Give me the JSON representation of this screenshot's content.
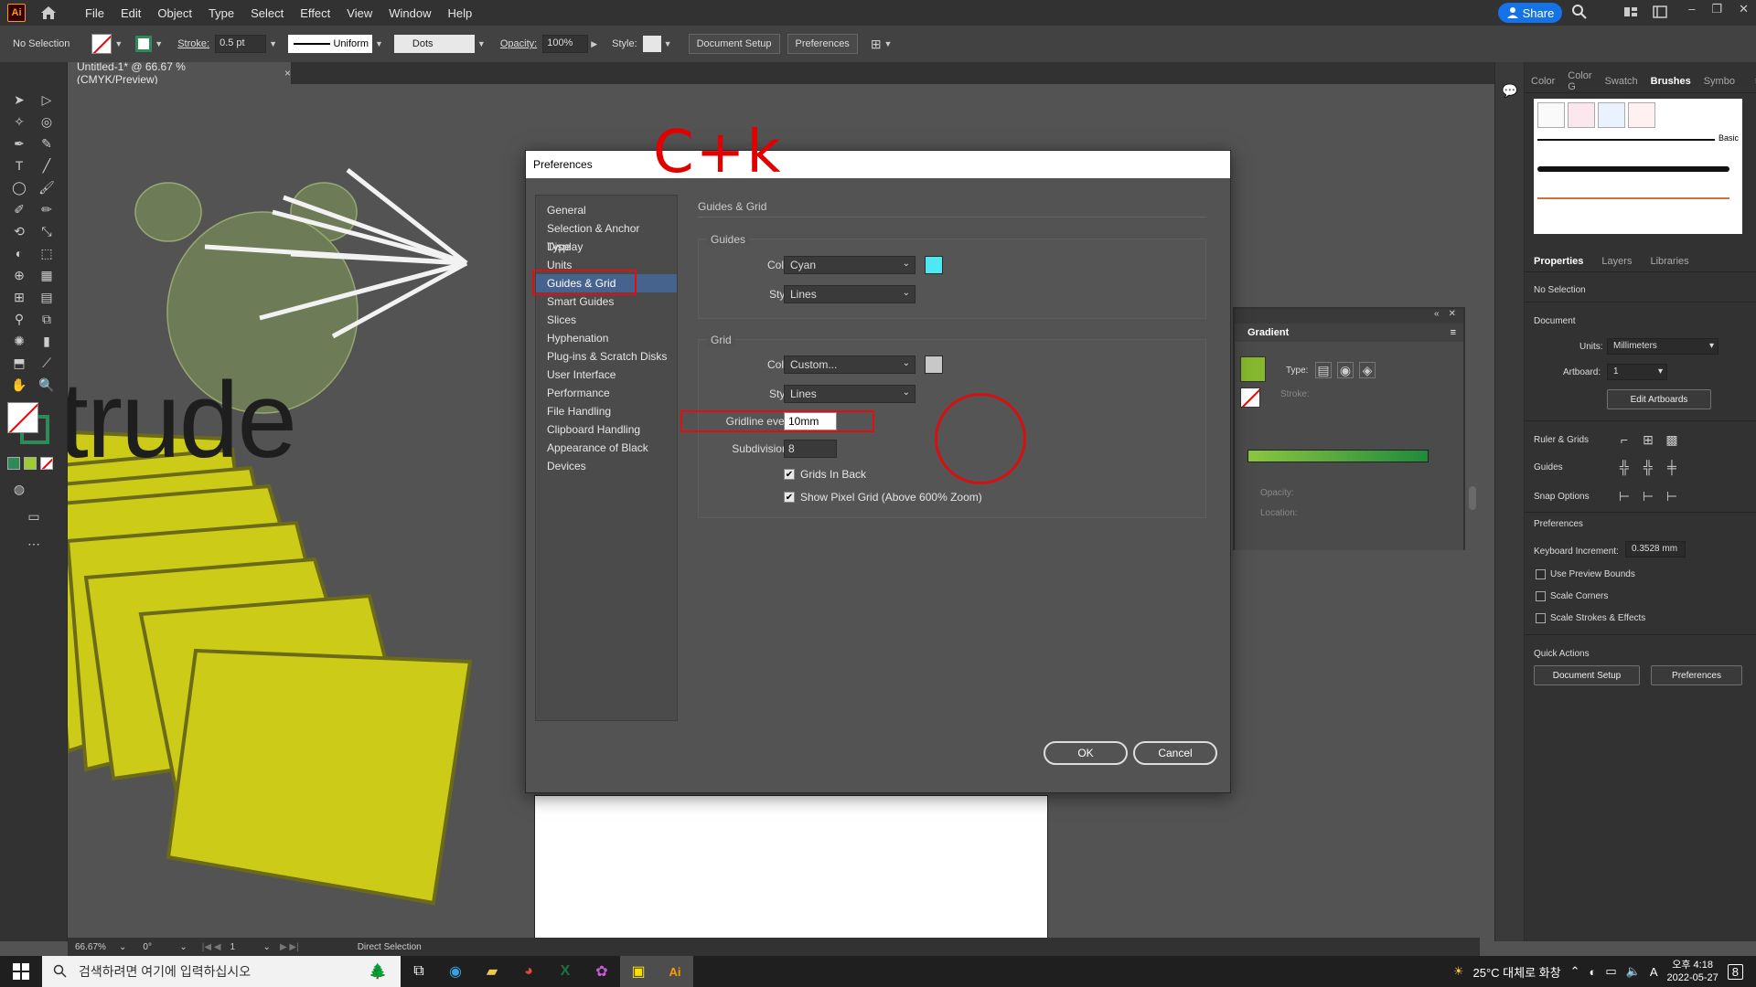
{
  "menubar": {
    "logo": "Ai",
    "items": [
      "File",
      "Edit",
      "Object",
      "Type",
      "Select",
      "Effect",
      "View",
      "Window",
      "Help"
    ],
    "share_label": "Share"
  },
  "controlbar": {
    "selection_text": "No Selection",
    "stroke_label": "Stroke:",
    "stroke_value": "0.5 pt",
    "stroke_profile": "Uniform",
    "brush_label": "Dots",
    "opacity_label": "Opacity:",
    "opacity_value": "100%",
    "style_label": "Style:",
    "document_setup_label": "Document Setup",
    "preferences_label": "Preferences"
  },
  "document_tab": {
    "title": "Untitled-1* @ 66.67 % (CMYK/Preview)",
    "close": "×"
  },
  "canvas": {
    "word": "trude"
  },
  "dialog": {
    "title": "Preferences",
    "categories": [
      "General",
      "Selection & Anchor Display",
      "Type",
      "Units",
      "Guides & Grid",
      "Smart Guides",
      "Slices",
      "Hyphenation",
      "Plug-ins & Scratch Disks",
      "User Interface",
      "Performance",
      "File Handling",
      "Clipboard Handling",
      "Appearance of Black",
      "Devices"
    ],
    "selected_category": "Guides & Grid",
    "content_title": "Guides & Grid",
    "guides": {
      "section": "Guides",
      "color_label": "Color:",
      "color_value": "Cyan",
      "color_hex": "#4de8f2",
      "style_label": "Style:",
      "style_value": "Lines"
    },
    "grid": {
      "section": "Grid",
      "color_label": "Color:",
      "color_value": "Custom...",
      "color_hex": "#c8c8c8",
      "style_label": "Style:",
      "style_value": "Lines",
      "gridline_label": "Gridline every:",
      "gridline_value": "10mm",
      "subdivisions_label": "Subdivisions:",
      "subdivisions_value": "8",
      "grids_in_back_label": "Grids In Back",
      "grids_in_back_checked": true,
      "pixel_grid_label": "Show Pixel Grid (Above 600% Zoom)",
      "pixel_grid_checked": true
    },
    "ok_label": "OK",
    "cancel_label": "Cancel",
    "annotation_text": "C+k"
  },
  "gradient_panel": {
    "title": "Gradient",
    "type_label": "Type:",
    "stroke_label": "Stroke:",
    "opacity_label": "Opacity:",
    "location_label": "Location:"
  },
  "right_panel": {
    "top_tabs": [
      "Color",
      "Color G",
      "Swatch",
      "Brushes",
      "Symbo"
    ],
    "active_top_tab": "Brushes",
    "brush_basic_label": "Basic",
    "prop_tabs": [
      "Properties",
      "Layers",
      "Libraries"
    ],
    "active_prop_tab": "Properties",
    "no_selection": "No Selection",
    "document_label": "Document",
    "units_label": "Units:",
    "units_value": "Millimeters",
    "artboard_label": "Artboard:",
    "artboard_value": "1",
    "edit_artboards_label": "Edit Artboards",
    "ruler_grids_label": "Ruler & Grids",
    "guides_label": "Guides",
    "snap_options_label": "Snap Options",
    "preferences_label": "Preferences",
    "keyboard_increment_label": "Keyboard Increment:",
    "keyboard_increment_value": "0.3528 mm",
    "use_preview_bounds": "Use Preview Bounds",
    "scale_corners": "Scale Corners",
    "scale_strokes": "Scale Strokes & Effects",
    "quick_actions_label": "Quick Actions",
    "document_setup_label": "Document Setup",
    "preferences_btn_label": "Preferences"
  },
  "statusbar": {
    "zoom": "66.67%",
    "rotate": "0°",
    "artboard_num": "1",
    "tool_name": "Direct Selection"
  },
  "taskbar": {
    "search_placeholder": "검색하려면 여기에 입력하십시오",
    "weather": "25°C 대체로 화창",
    "time": "오후 4:18",
    "date": "2022-05-27",
    "notifications": "8",
    "ime": "A"
  }
}
